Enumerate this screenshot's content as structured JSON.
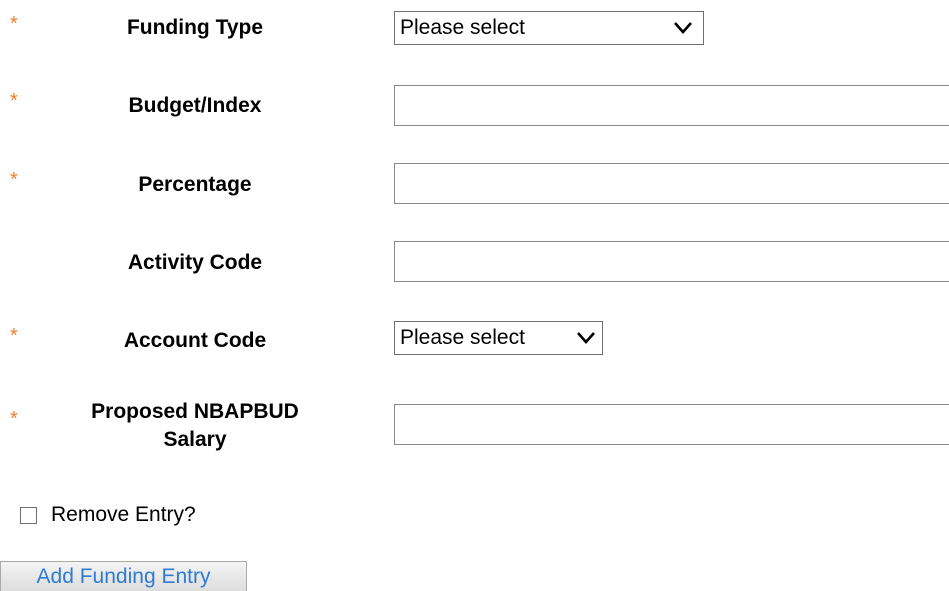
{
  "colors": {
    "required_marker": "#f07d30",
    "button_text": "#2e7bd3"
  },
  "form": {
    "fields": [
      {
        "id": "funding_type",
        "label": "Funding Type",
        "required": true,
        "type": "select",
        "value": "Please select"
      },
      {
        "id": "budget_index",
        "label": "Budget/Index",
        "required": true,
        "type": "text",
        "value": ""
      },
      {
        "id": "percentage",
        "label": "Percentage",
        "required": true,
        "type": "text",
        "value": ""
      },
      {
        "id": "activity_code",
        "label": "Activity Code",
        "required": false,
        "type": "text",
        "value": ""
      },
      {
        "id": "account_code",
        "label": "Account Code",
        "required": true,
        "type": "select",
        "value": "Please select"
      },
      {
        "id": "proposed_salary",
        "label_line1": "Proposed NBAPBUD",
        "label_line2": "Salary",
        "required": true,
        "type": "text",
        "value": ""
      }
    ],
    "required_marker": "*",
    "remove_entry": {
      "label": "Remove Entry?",
      "checked": false
    },
    "add_button_label": "Add Funding Entry"
  },
  "icons": {
    "select_arrow": "chevron-down-icon"
  }
}
